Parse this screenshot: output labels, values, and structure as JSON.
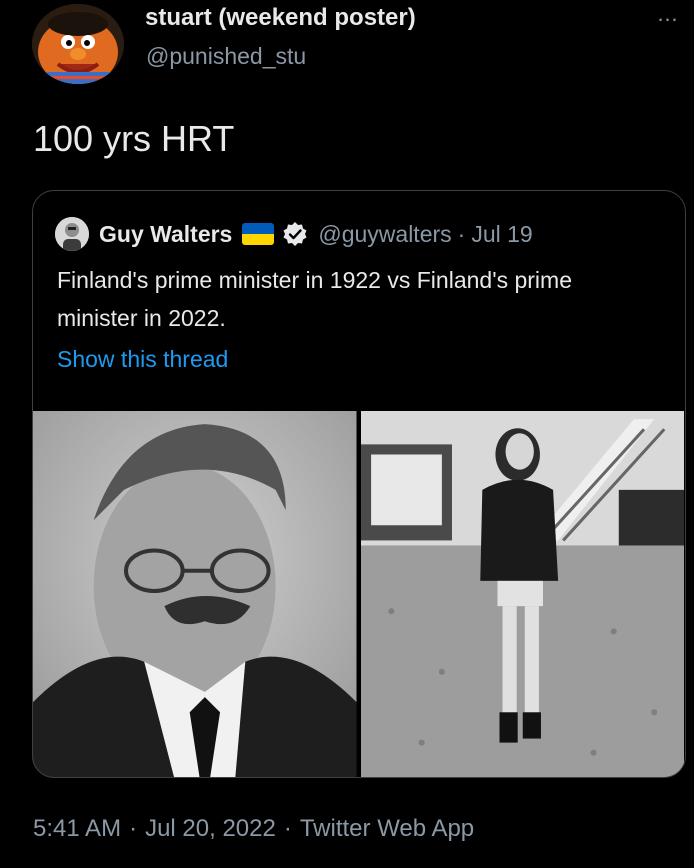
{
  "author": {
    "display_name": "stuart (weekend poster)",
    "handle": "@punished_stu",
    "avatar_icon": "orange-muppet-avatar"
  },
  "tweet": {
    "text": "100 yrs HRT"
  },
  "more_icon": "…",
  "quoted_tweet": {
    "display_name": "Guy Walters",
    "flag_icon": "ukraine-flag-icon",
    "verified_icon": "verified-badge-icon",
    "handle": "@guywalters",
    "separator": "·",
    "date": "Jul 19",
    "text": "Finland's prime minister in 1922 vs Finland's prime minister in 2022.",
    "show_thread_label": "Show this thread",
    "photos": [
      {
        "icon": "photo-1922-prime-minister"
      },
      {
        "icon": "photo-2022-prime-minister"
      }
    ]
  },
  "meta": {
    "time": "5:41 AM",
    "separator": "·",
    "date": "Jul 20, 2022",
    "via": "Twitter Web App"
  },
  "colors": {
    "background": "#000000",
    "primary_text": "#e7e9ea",
    "secondary_text": "#8b98a5",
    "link": "#1d9bf0",
    "border": "#3b4148",
    "flag_blue": "#005bbb",
    "flag_yellow": "#ffd500"
  }
}
